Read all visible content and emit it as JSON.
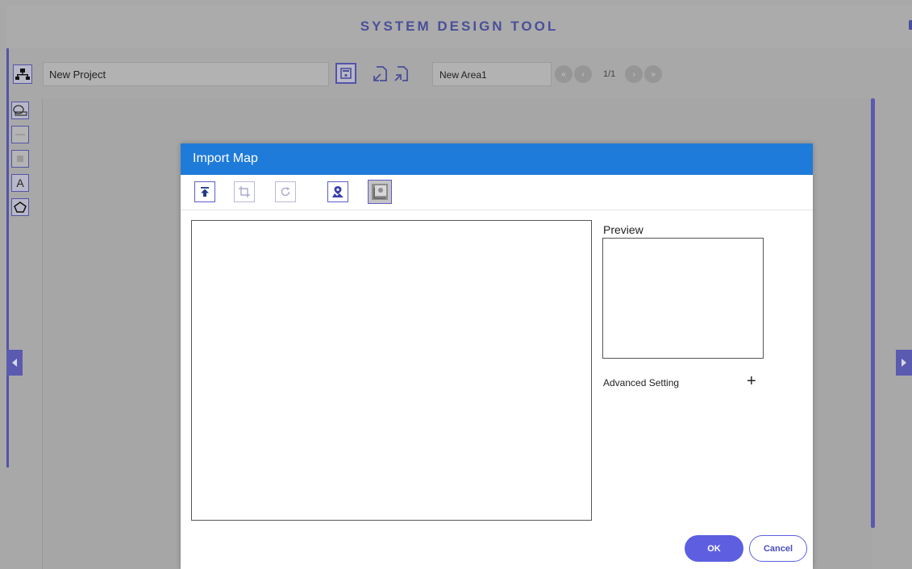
{
  "app": {
    "title": "SYSTEM DESIGN TOOL",
    "project_name": "New Project",
    "area_name": "New Area1",
    "page_indicator": "1/1",
    "pager": {
      "first": "«",
      "prev": "‹",
      "next": "›",
      "last": "»"
    }
  },
  "left_toolbar": {
    "text_tool": "A"
  },
  "dialog": {
    "title": "Import Map",
    "preview_label": "Preview",
    "advanced_setting_label": "Advanced Setting",
    "advanced_toggle": "+",
    "ok_label": "OK",
    "cancel_label": "Cancel"
  }
}
